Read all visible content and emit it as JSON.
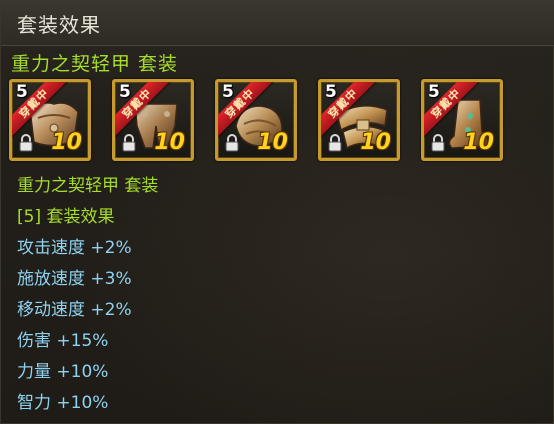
{
  "header": {
    "title": "套装效果"
  },
  "set": {
    "name_line": "重力之契轻甲 套装"
  },
  "items": [
    {
      "count": "5",
      "badge": "穿戴中",
      "level": "10",
      "piece": "chest"
    },
    {
      "count": "5",
      "badge": "穿戴中",
      "level": "10",
      "piece": "pants"
    },
    {
      "count": "5",
      "badge": "穿戴中",
      "level": "10",
      "piece": "shoulder"
    },
    {
      "count": "5",
      "badge": "穿戴中",
      "level": "10",
      "piece": "belt"
    },
    {
      "count": "5",
      "badge": "穿戴中",
      "level": "10",
      "piece": "boots"
    }
  ],
  "effects": {
    "set_name": "重力之契轻甲 套装",
    "tier_label": "[5] 套装效果",
    "lines": [
      "攻击速度 +2%",
      "施放速度 +3%",
      "移动速度 +2%",
      "伤害 +15%",
      "力量 +10%",
      "智力 +10%"
    ]
  },
  "colors": {
    "set_green": "#a6dc2c",
    "effect_blue": "#8fd2f0",
    "frame_gold": "#c79a2e",
    "badge_red": "#d61f25",
    "level_yellow": "#ffd21e"
  }
}
